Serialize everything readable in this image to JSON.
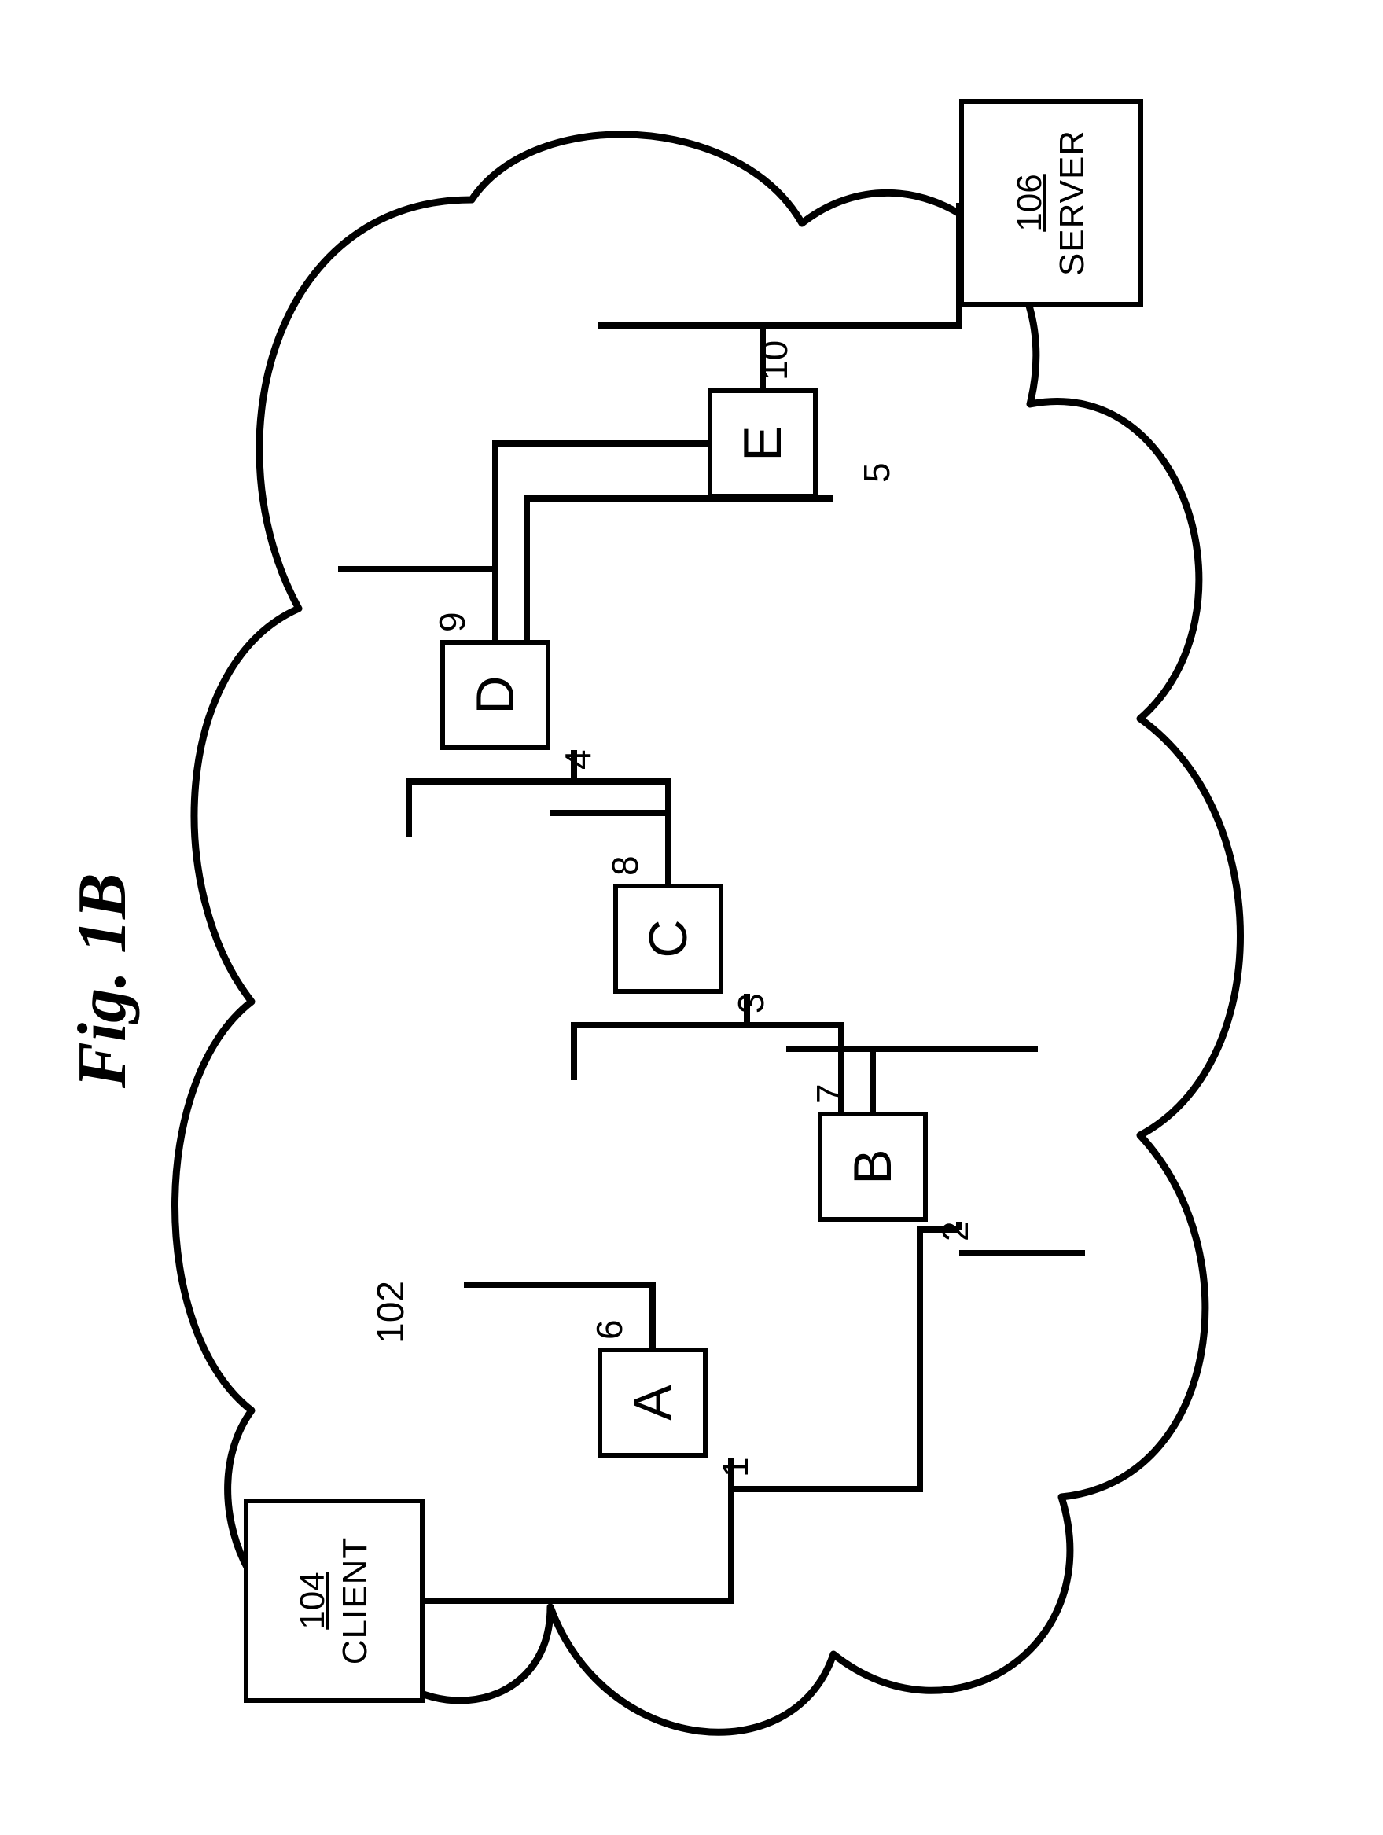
{
  "figure": {
    "title": "Fig. 1B"
  },
  "cloud": {
    "ref": "102"
  },
  "client": {
    "ref": "104",
    "label": "CLIENT"
  },
  "server": {
    "ref": "106",
    "label": "SERVER"
  },
  "nodes": {
    "A": "A",
    "B": "B",
    "C": "C",
    "D": "D",
    "E": "E"
  },
  "interfaces": {
    "n1": "1",
    "n2": "2",
    "n3": "3",
    "n4": "4",
    "n5": "5",
    "n6": "6",
    "n7": "7",
    "n8": "8",
    "n9": "9",
    "n10": "10"
  }
}
